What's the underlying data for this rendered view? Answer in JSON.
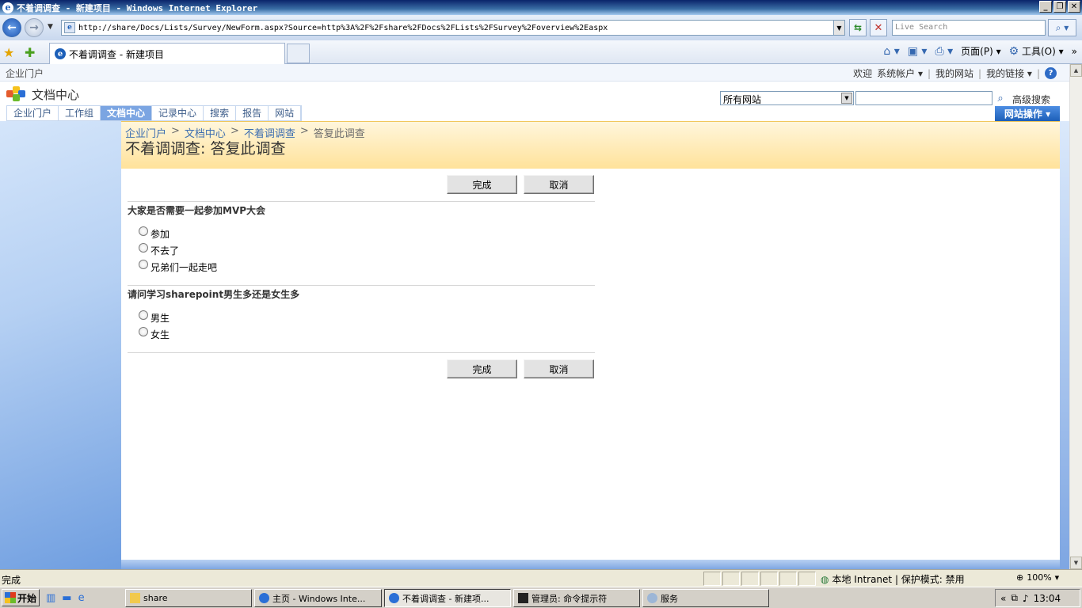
{
  "window": {
    "title": "不着调调查 - 新建项目 - Windows Internet Explorer",
    "buttons": [
      "_",
      "❐",
      "✕"
    ]
  },
  "addressbar": {
    "url": "http://share/Docs/Lists/Survey/NewForm.aspx?Source=http%3A%2F%2Fshare%2FDocs%2FLists%2FSurvey%2Foverview%2Easpx",
    "search_placeholder": "Live Search"
  },
  "tab": {
    "label": "不着调调查 - 新建项目"
  },
  "commandbar": {
    "page": "页面(P)",
    "tools": "工具(O)"
  },
  "sharepoint": {
    "portal": "企业门户",
    "welcome": "欢迎",
    "account": "系统帐户",
    "my_site": "我的网站",
    "my_links": "我的链接",
    "site_name": "文档中心",
    "search_scope": "所有网站",
    "advanced_search": "高级搜索",
    "nav": [
      "企业门户",
      "工作组",
      "文档中心",
      "记录中心",
      "搜索",
      "报告",
      "网站"
    ],
    "site_actions": "网站操作"
  },
  "page": {
    "breadcrumb": [
      "企业门户",
      "文档中心",
      "不着调调查",
      "答复此调查"
    ],
    "title": "不着调调查: 答复此调查",
    "finish_label": "完成",
    "cancel_label": "取消",
    "questions": [
      {
        "text": "大家是否需要一起参加MVP大会",
        "options": [
          "参加",
          "不去了",
          "兄弟们一起走吧"
        ]
      },
      {
        "text": "请问学习sharepoint男生多还是女生多",
        "options": [
          "男生",
          "女生"
        ]
      }
    ]
  },
  "statusbar": {
    "status": "完成",
    "zone": "本地 Intranet | 保护模式: 禁用",
    "zoom": "100%"
  },
  "taskbar": {
    "start": "开始",
    "tasks": [
      "share",
      "主页 - Windows Inte...",
      "不着调调查 - 新建项...",
      "管理员: 命令提示符",
      "服务"
    ],
    "clock": "13:04"
  }
}
